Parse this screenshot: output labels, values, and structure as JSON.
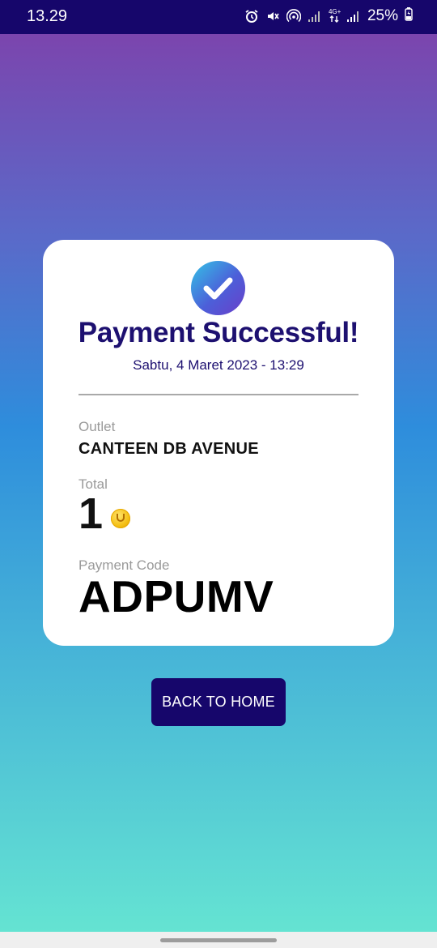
{
  "status_bar": {
    "time": "13.29",
    "network_label_top": "4G+",
    "battery": "25%",
    "icons": [
      "alarm-icon",
      "mute-icon",
      "hotspot-icon",
      "signal-icon",
      "data-arrows-icon",
      "signal-icon",
      "battery-charging-icon"
    ]
  },
  "card": {
    "title": "Payment Successful!",
    "date": "Sabtu, 4 Maret 2023 - 13:29",
    "outlet_label": "Outlet",
    "outlet_value": "CANTEEN DB AVENUE",
    "total_label": "Total",
    "total_value": "1",
    "payment_code_label": "Payment Code",
    "payment_code_value": "ADPUMV"
  },
  "actions": {
    "back_home_label": "BACK TO HOME"
  },
  "colors": {
    "primary": "#16066b",
    "title": "#1d1070",
    "gradient_top": "#7c44ad",
    "gradient_mid": "#2e8ddc",
    "gradient_bottom": "#66e6d2",
    "coin": "#f4bf14"
  }
}
